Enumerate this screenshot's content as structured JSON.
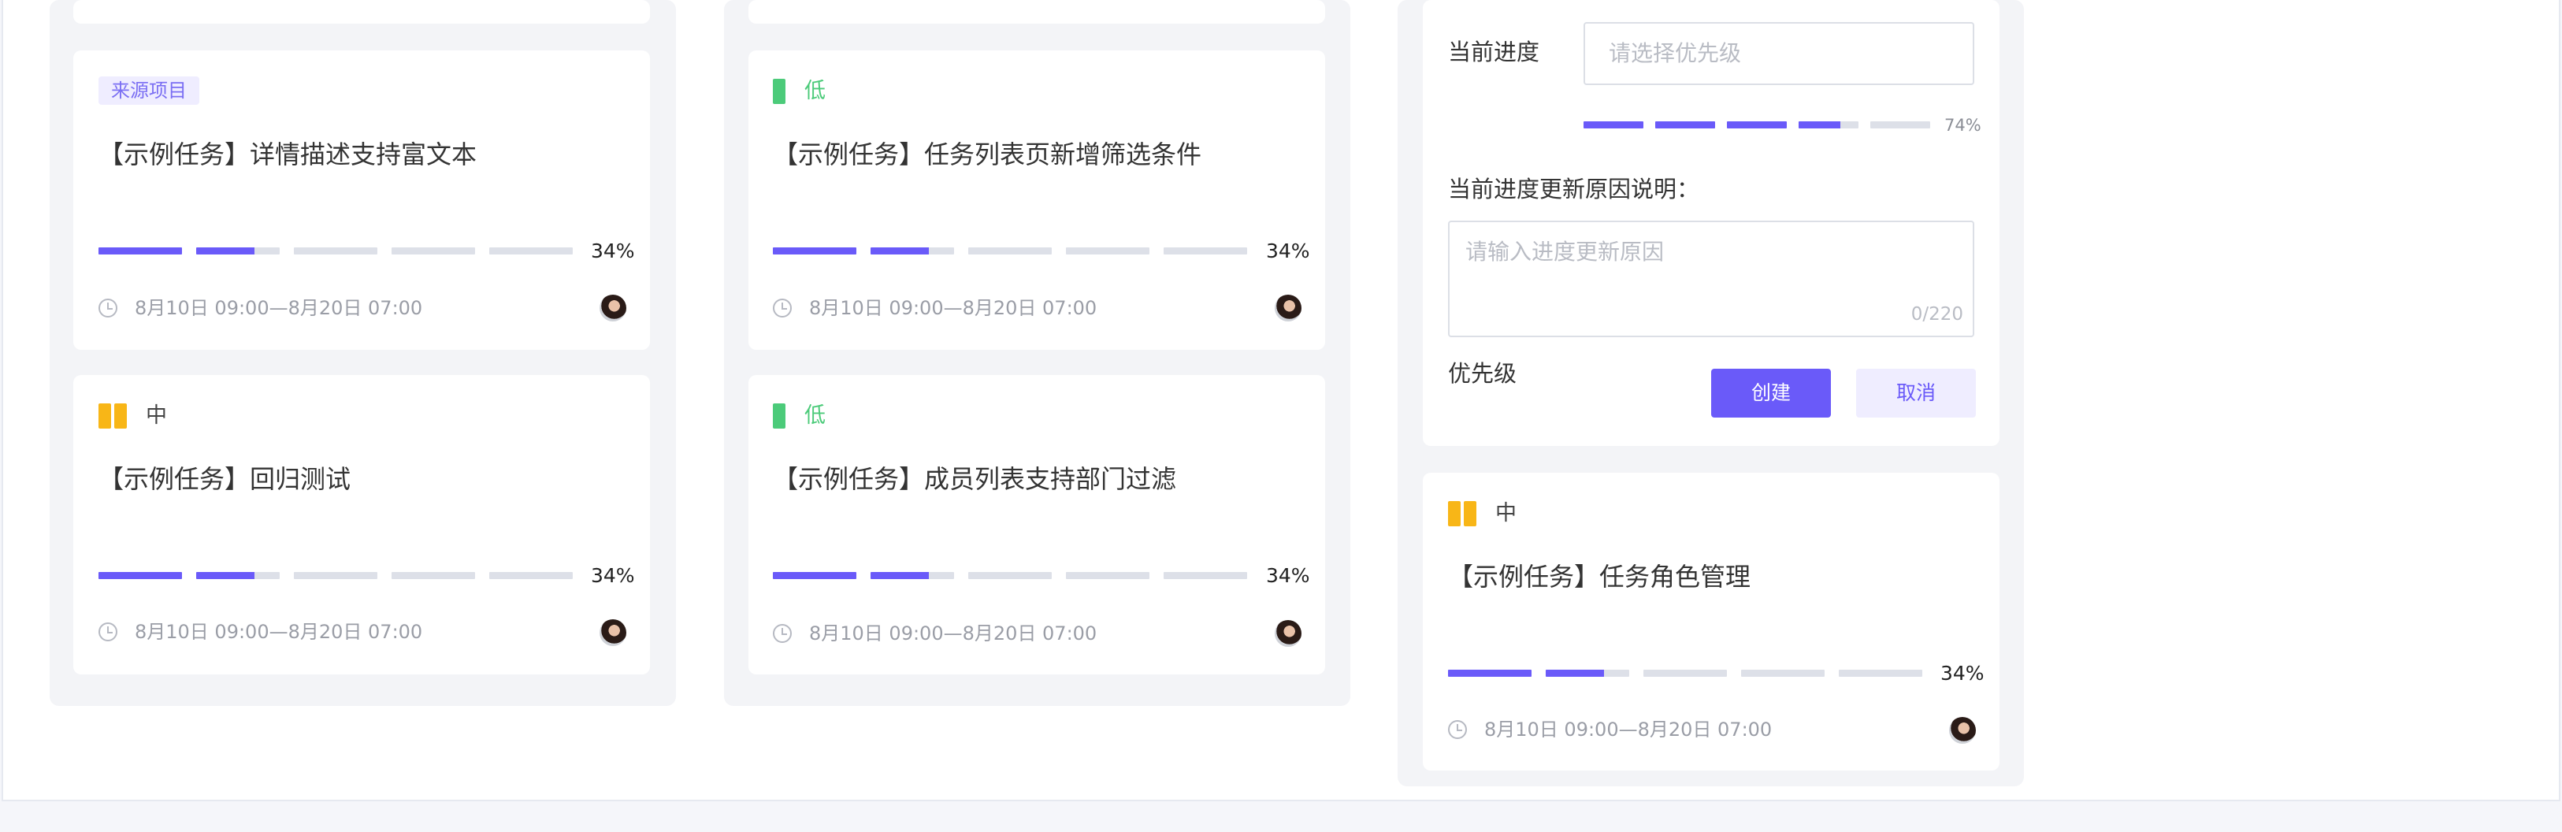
{
  "colors": {
    "accent": "#6a5af9",
    "priority_low": "#4ccb7a",
    "priority_medium": "#f8b617",
    "tag_text": "#7b6ff3",
    "tag_bg": "#efedff"
  },
  "cards": [
    {
      "tag": "来源项目",
      "title": "【示例任务】详情描述支持富文本",
      "progress_percent": 34,
      "progress_label": "34%",
      "time": "8月10日 09:00—8月20日 07:00",
      "assignee_icon": "avatar"
    },
    {
      "priority": {
        "icon": "priority-medium-icon",
        "label": "中"
      },
      "title": "【示例任务】回归测试",
      "progress_percent": 34,
      "progress_label": "34%",
      "time": "8月10日 09:00—8月20日 07:00",
      "assignee_icon": "avatar"
    },
    {
      "priority": {
        "icon": "priority-low-icon",
        "label": "低"
      },
      "title": "【示例任务】任务列表页新增筛选条件",
      "progress_percent": 34,
      "progress_label": "34%",
      "time": "8月10日 09:00—8月20日 07:00",
      "assignee_icon": "avatar"
    },
    {
      "priority": {
        "icon": "priority-low-icon",
        "label": "低"
      },
      "title": "【示例任务】成员列表支持部门过滤",
      "progress_percent": 34,
      "progress_label": "34%",
      "time": "8月10日 09:00—8月20日 07:00",
      "assignee_icon": "avatar"
    },
    {
      "priority": {
        "icon": "priority-medium-icon",
        "label": "中"
      },
      "title": "【示例任务】任务角色管理",
      "progress_percent": 34,
      "progress_label": "34%",
      "time": "8月10日 09:00—8月20日 07:00",
      "assignee_icon": "avatar"
    }
  ],
  "form": {
    "progress_label": "当前进度",
    "progress_placeholder": "请选择优先级",
    "progress_percent": 74,
    "progress_value_label": "74%",
    "reason_label": "当前进度更新原因说明：",
    "reason_placeholder": "请输入进度更新原因",
    "reason_counter": "0/220",
    "priority_label": "优先级",
    "create_button": "创建",
    "cancel_button": "取消"
  }
}
